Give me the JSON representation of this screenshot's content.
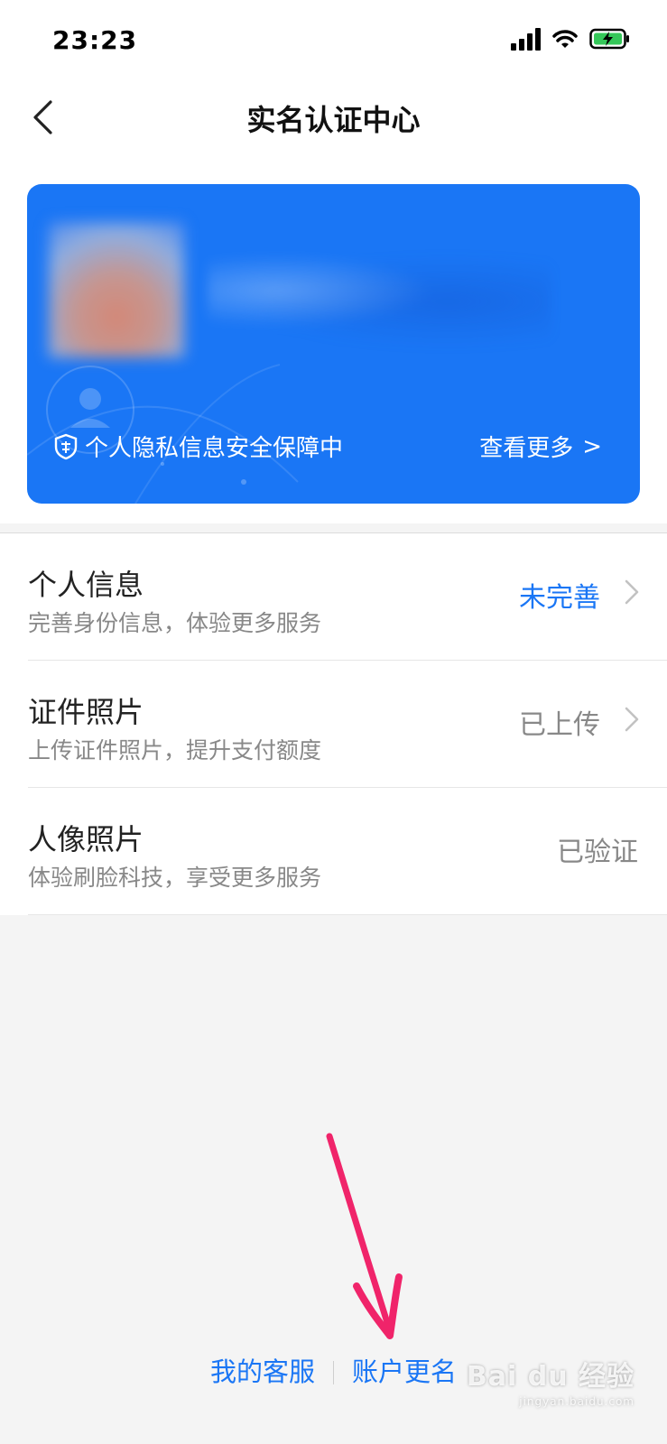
{
  "status_bar": {
    "time": "23:23"
  },
  "nav": {
    "title": "实名认证中心"
  },
  "card": {
    "privacy_text": "个人隐私信息安全保障中",
    "view_more": "查看更多",
    "view_more_chevron": ">"
  },
  "items": [
    {
      "title": "个人信息",
      "subtitle": "完善身份信息，体验更多服务",
      "status": "未完善",
      "status_color": "#1a76f5",
      "chevron": true
    },
    {
      "title": "证件照片",
      "subtitle": "上传证件照片，提升支付额度",
      "status": "已上传",
      "status_color": "#888888",
      "chevron": true
    },
    {
      "title": "人像照片",
      "subtitle": "体验刷脸科技，享受更多服务",
      "status": "已验证",
      "status_color": "#888888",
      "chevron": false
    }
  ],
  "footer": {
    "customer_service": "我的客服",
    "rename": "账户更名"
  },
  "watermark": {
    "text": "Bai du 经验",
    "sub": "jingyan.baidu.com"
  },
  "colors": {
    "accent": "#1a76f5",
    "annotation_arrow": "#f0246a"
  }
}
